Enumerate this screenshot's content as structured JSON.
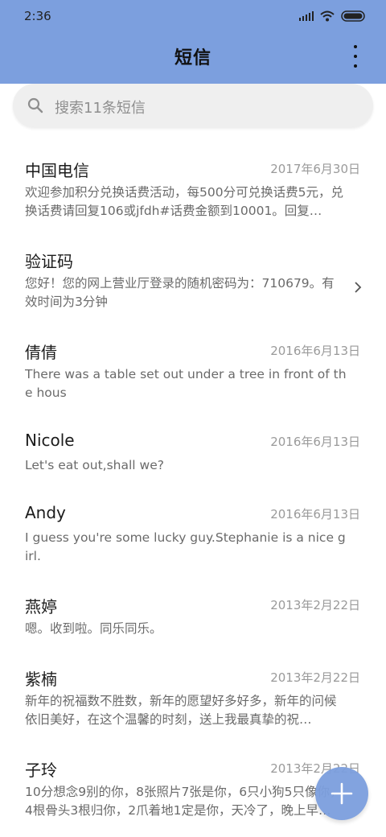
{
  "status_bar": {
    "time": "2:36"
  },
  "header": {
    "title": "短信"
  },
  "search": {
    "placeholder": "搜索11条短信"
  },
  "messages": [
    {
      "name": "中国电信",
      "date": "2017年6月30日",
      "preview": "欢迎参加积分兑换话费活动，每500分可兑换话费5元，兑换话费请回复106或jfdh#话费金额到10001。回复…"
    },
    {
      "name": "验证码",
      "date": "",
      "preview": "您好！您的网上营业厅登录的随机密码为：710679。有效时间为3分钟"
    },
    {
      "name": "倩倩",
      "date": "2016年6月13日",
      "preview": "There was a table set out under a tree in front of the hous"
    },
    {
      "name": "Nicole",
      "date": "2016年6月13日",
      "preview": "Let's eat out,shall we?"
    },
    {
      "name": "Andy",
      "date": "2016年6月13日",
      "preview": "I guess you're some lucky guy.Stephanie is a nice girl."
    },
    {
      "name": "燕婷",
      "date": "2013年2月22日",
      "preview": "嗯。收到啦。同乐同乐。"
    },
    {
      "name": "紫楠",
      "date": "2013年2月22日",
      "preview": "新年的祝福数不胜数，新年的愿望好多好多，新年的问候依旧美好，在这个温馨的时刻，送上我最真挚的祝…"
    },
    {
      "name": "子玲",
      "date": "2013年2月22日",
      "preview": "10分想念9别的你，8张照片7张是你，6只小狗5只像你，4根骨头3根归你，2爪着地1定是你，天冷了，晚上早…"
    }
  ],
  "colors": {
    "accent": "#7c9fde",
    "background": "#ffffff",
    "search_bg": "#efefef"
  },
  "icons": [
    "signal-icon",
    "wifi-icon",
    "battery-icon",
    "more-vert-icon",
    "search-icon",
    "chevron-right-icon",
    "plus-icon"
  ]
}
